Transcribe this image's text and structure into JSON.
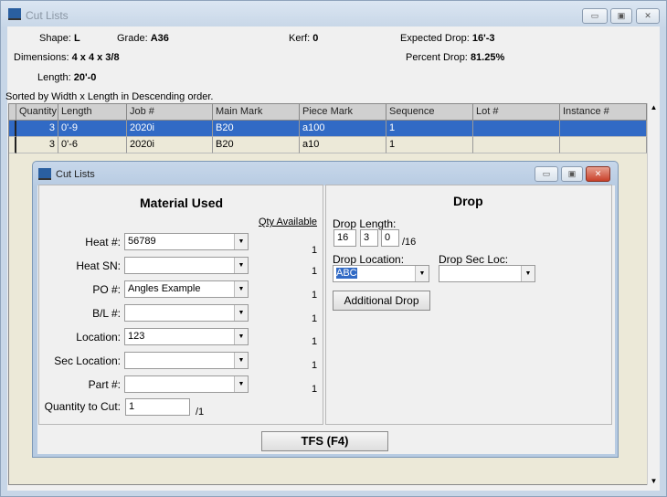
{
  "window": {
    "title": "Cut Lists",
    "min": "▭",
    "max": "▣",
    "close": "✕"
  },
  "summary": {
    "shape_label": "Shape:",
    "shape": "L",
    "grade_label": "Grade:",
    "grade": "A36",
    "kerf_label": "Kerf:",
    "kerf": "0",
    "expected_drop_label": "Expected Drop:",
    "expected_drop": "16'-3",
    "dimensions_label": "Dimensions:",
    "dimensions": "4 x 4 x 3/8",
    "percent_drop_label": "Percent Drop:",
    "percent_drop": "81.25%",
    "length_label": "Length:",
    "length": "20'-0"
  },
  "sort_note": "Sorted by Width x Length in Descending order.",
  "grid": {
    "columns": [
      "Quantity",
      "Length",
      "Job #",
      "Main Mark",
      "Piece Mark",
      "Sequence",
      "Lot #",
      "Instance #"
    ],
    "rows": [
      [
        "3",
        "0'-9",
        "2020i",
        "B20",
        "a100",
        "1",
        "",
        ""
      ],
      [
        "3",
        "0'-6",
        "2020i",
        "B20",
        "a10",
        "1",
        "",
        ""
      ]
    ]
  },
  "dialog": {
    "title": "Cut Lists",
    "material_title": "Material Used",
    "qty_available": "Qty Available",
    "fields": [
      {
        "label": "Heat #:",
        "value": "56789",
        "qty": "1"
      },
      {
        "label": "Heat SN:",
        "value": "",
        "qty": "1"
      },
      {
        "label": "PO #:",
        "value": "Angles Example",
        "qty": "1"
      },
      {
        "label": "B/L #:",
        "value": "",
        "qty": "1"
      },
      {
        "label": "Location:",
        "value": "123",
        "qty": "1"
      },
      {
        "label": "Sec Location:",
        "value": "",
        "qty": "1"
      },
      {
        "label": "Part #:",
        "value": "",
        "qty": "1"
      }
    ],
    "qty_to_cut_label": "Quantity to Cut:",
    "qty_to_cut": "1",
    "qty_to_cut_max": "/1",
    "drop_title": "Drop",
    "drop_length_label": "Drop Length:",
    "drop_ft": "16",
    "drop_in": "3",
    "drop_frac": "0",
    "drop_frac_denom": "/16",
    "drop_location_label": "Drop Location:",
    "drop_location": "ABC",
    "drop_sec_loc_label": "Drop Sec Loc:",
    "drop_sec_loc": "",
    "additional_drop": "Additional Drop",
    "tfs": "TFS (F4)"
  }
}
